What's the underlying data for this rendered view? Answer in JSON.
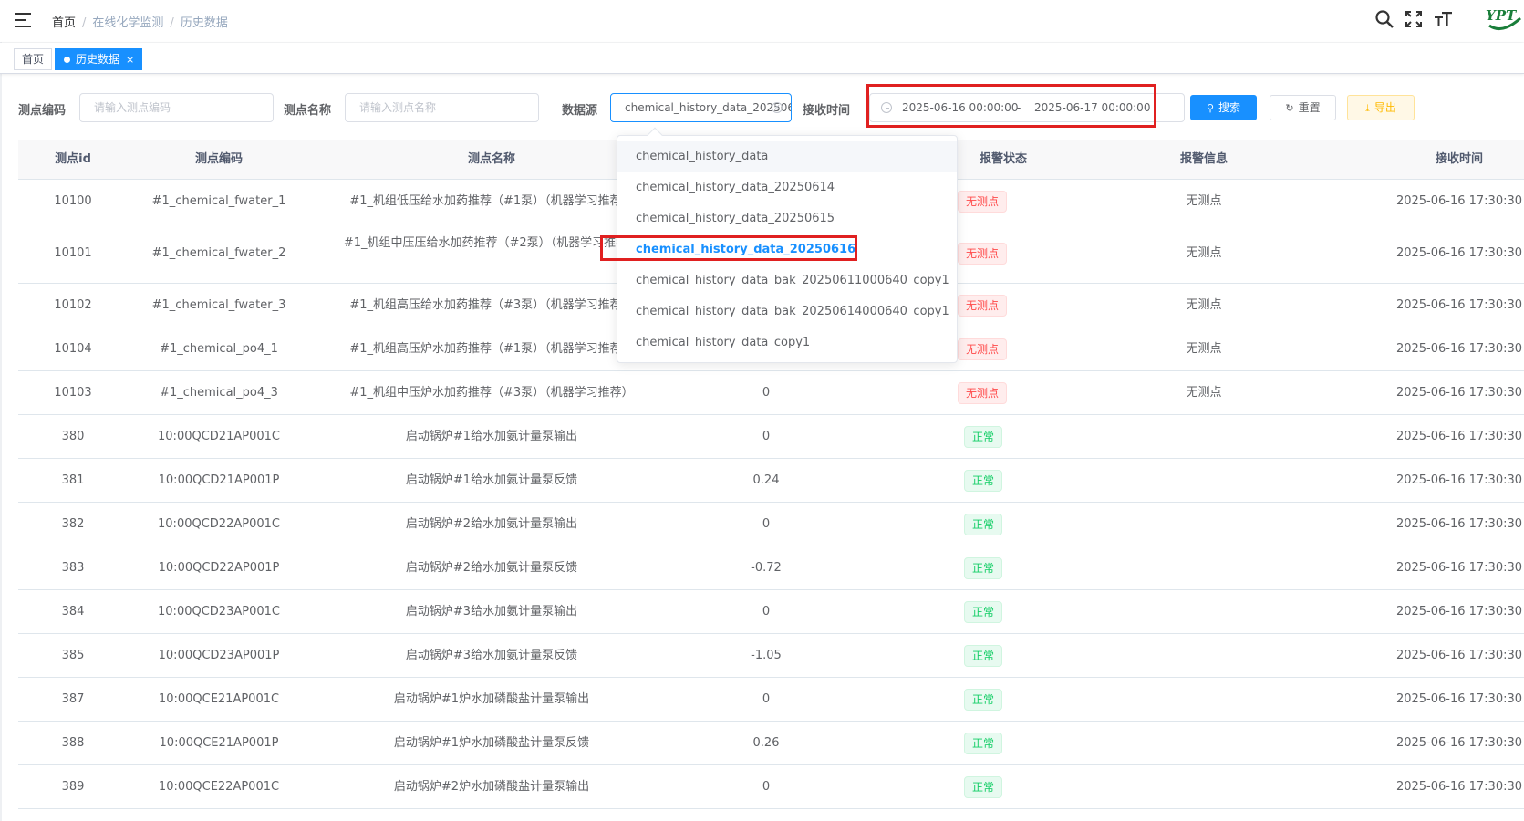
{
  "breadcrumb": {
    "home": "首页",
    "level1": "在线化学监测",
    "level2": "历史数据"
  },
  "logo": {
    "text": "YPT"
  },
  "tags": [
    {
      "label": "首页"
    },
    {
      "label": "历史数据",
      "close": "×"
    }
  ],
  "form": {
    "code_label": "测点编码",
    "code_placeholder": "请输入测点编码",
    "name_label": "测点名称",
    "name_placeholder": "请输入测点名称",
    "source_label": "数据源",
    "source_value": "chemical_history_data_20250616",
    "time_label": "接收时间",
    "time_start": "2025-06-16 00:00:00",
    "time_sep": "-",
    "time_end": "2025-06-17 00:00:00",
    "search_label": "搜索",
    "reset_label": "重置",
    "export_label": "导出"
  },
  "dropdown_options": [
    "chemical_history_data",
    "chemical_history_data_20250614",
    "chemical_history_data_20250615",
    "chemical_history_data_20250616",
    "chemical_history_data_bak_20250611000640_copy1",
    "chemical_history_data_bak_20250614000640_copy1",
    "chemical_history_data_copy1"
  ],
  "table": {
    "headers": [
      "测点id",
      "测点编码",
      "测点名称",
      "报警状态",
      "报警信息",
      "接收时间"
    ],
    "rows": [
      {
        "id": "10100",
        "code": "#1_chemical_fwater_1",
        "name": "#1_机组低压给水加药推荐（#1泵）（机器学习推荐）",
        "value": "",
        "status": "无测点",
        "info": "无测点",
        "time": "2025-06-16 17:30:30"
      },
      {
        "id": "10101",
        "code": "#1_chemical_fwater_2",
        "name": "#1_机组中压压给水加药推荐（#2泵）（机器学习推荐）",
        "value": "",
        "status": "无测点",
        "info": "无测点",
        "time": "2025-06-16 17:30:30"
      },
      {
        "id": "10102",
        "code": "#1_chemical_fwater_3",
        "name": "#1_机组高压给水加药推荐（#3泵）（机器学习推荐）",
        "value": "",
        "status": "无测点",
        "info": "无测点",
        "time": "2025-06-16 17:30:30"
      },
      {
        "id": "10104",
        "code": "#1_chemical_po4_1",
        "name": "#1_机组高压炉水加药推荐（#1泵）（机器学习推荐）",
        "value": "",
        "status": "无测点",
        "info": "无测点",
        "time": "2025-06-16 17:30:30"
      },
      {
        "id": "10103",
        "code": "#1_chemical_po4_3",
        "name": "#1_机组中压炉水加药推荐（#3泵）（机器学习推荐）",
        "value": "0",
        "status": "无测点",
        "info": "无测点",
        "time": "2025-06-16 17:30:30"
      },
      {
        "id": "380",
        "code": "10:00QCD21AP001C",
        "name": "启动锅炉#1给水加氨计量泵输出",
        "value": "0",
        "status": "正常",
        "info": "",
        "time": "2025-06-16 17:30:30"
      },
      {
        "id": "381",
        "code": "10:00QCD21AP001P",
        "name": "启动锅炉#1给水加氨计量泵反馈",
        "value": "0.24",
        "status": "正常",
        "info": "",
        "time": "2025-06-16 17:30:30"
      },
      {
        "id": "382",
        "code": "10:00QCD22AP001C",
        "name": "启动锅炉#2给水加氨计量泵输出",
        "value": "0",
        "status": "正常",
        "info": "",
        "time": "2025-06-16 17:30:30"
      },
      {
        "id": "383",
        "code": "10:00QCD22AP001P",
        "name": "启动锅炉#2给水加氨计量泵反馈",
        "value": "-0.72",
        "status": "正常",
        "info": "",
        "time": "2025-06-16 17:30:30"
      },
      {
        "id": "384",
        "code": "10:00QCD23AP001C",
        "name": "启动锅炉#3给水加氨计量泵输出",
        "value": "0",
        "status": "正常",
        "info": "",
        "time": "2025-06-16 17:30:30"
      },
      {
        "id": "385",
        "code": "10:00QCD23AP001P",
        "name": "启动锅炉#3给水加氨计量泵反馈",
        "value": "-1.05",
        "status": "正常",
        "info": "",
        "time": "2025-06-16 17:30:30"
      },
      {
        "id": "387",
        "code": "10:00QCE21AP001C",
        "name": "启动锅炉#1炉水加磷酸盐计量泵输出",
        "value": "0",
        "status": "正常",
        "info": "",
        "time": "2025-06-16 17:30:30"
      },
      {
        "id": "388",
        "code": "10:00QCE21AP001P",
        "name": "启动锅炉#1炉水加磷酸盐计量泵反馈",
        "value": "0.26",
        "status": "正常",
        "info": "",
        "time": "2025-06-16 17:30:30"
      },
      {
        "id": "389",
        "code": "10:00QCE22AP001C",
        "name": "启动锅炉#2炉水加磷酸盐计量泵输出",
        "value": "0",
        "status": "正常",
        "info": "",
        "time": "2025-06-16 17:30:30"
      }
    ]
  },
  "colors": {
    "primary": "#1890ff",
    "danger": "#ff4949",
    "success": "#13ce66",
    "warning": "#ffba00",
    "highlight": "#e02020"
  }
}
